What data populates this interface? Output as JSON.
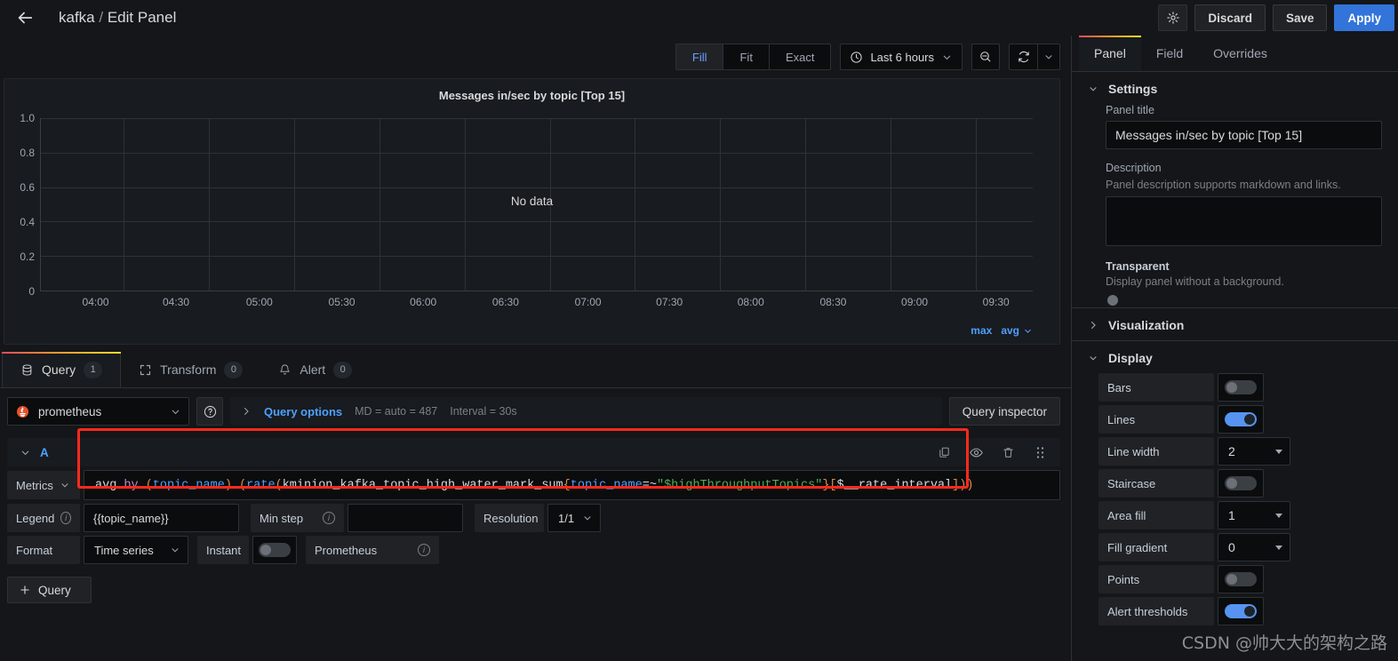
{
  "topbar": {
    "back_icon": "arrow-left-icon",
    "breadcrumb_dashboard": "kafka",
    "breadcrumb_sep": "/",
    "breadcrumb_page": "Edit Panel",
    "settings_icon": "gear-icon",
    "discard_label": "Discard",
    "save_label": "Save",
    "apply_label": "Apply"
  },
  "viz_toolbar": {
    "fit_modes": [
      "Fill",
      "Fit",
      "Exact"
    ],
    "active_fit_mode": "Fill",
    "time_range": "Last 6 hours",
    "clock_icon": "clock-icon",
    "chevron_icon": "chevron-down-icon",
    "zoom_out_icon": "zoom-out-icon",
    "refresh_icon": "refresh-icon",
    "refresh_interval_icon": "chevron-down-icon"
  },
  "chart_data": {
    "type": "line",
    "title": "Messages in/sec by topic [Top 15]",
    "no_data_text": "No data",
    "xlabel": "",
    "ylabel": "",
    "x": [
      "04:00",
      "04:30",
      "05:00",
      "05:30",
      "06:00",
      "06:30",
      "07:00",
      "07:30",
      "08:00",
      "08:30",
      "09:00",
      "09:30"
    ],
    "yticks": [
      "1.0",
      "0.8",
      "0.6",
      "0.4",
      "0.2",
      "0"
    ],
    "ylim": [
      0,
      1.0
    ],
    "series": [],
    "grid": true,
    "legend_position": "bottom-right",
    "legend_calcs": [
      "max",
      "avg"
    ]
  },
  "query_tabs": [
    {
      "label": "Query",
      "count": "1",
      "icon": "database-icon",
      "active": true
    },
    {
      "label": "Transform",
      "count": "0",
      "icon": "transform-icon",
      "active": false
    },
    {
      "label": "Alert",
      "count": "0",
      "icon": "bell-icon",
      "active": false
    }
  ],
  "query_header": {
    "datasource": "prometheus",
    "datasource_icon": "prometheus-logo-icon",
    "datasource_chevron": "chevron-down-icon",
    "help_icon": "question-circle-icon",
    "expand_icon": "chevron-right-icon",
    "query_options_label": "Query options",
    "max_data_points": "MD = auto = 487",
    "interval": "Interval = 30s",
    "query_inspector_label": "Query inspector"
  },
  "query_row": {
    "ref_id": "A",
    "collapse_icon": "chevron-down-icon",
    "actions": [
      "copy-icon",
      "eye-icon",
      "trash-icon",
      "drag-handle-icon"
    ],
    "metrics_label": "Metrics",
    "metrics_chevron": "chevron-down-icon",
    "expression_tokens": [
      {
        "t": "avg ",
        "c": "fn"
      },
      {
        "t": "by",
        "c": "kw"
      },
      {
        "t": " ",
        "c": "fn"
      },
      {
        "t": "(",
        "c": "paren"
      },
      {
        "t": "topic_name",
        "c": "label"
      },
      {
        "t": ")",
        "c": "paren"
      },
      {
        "t": " ",
        "c": "fn"
      },
      {
        "t": "(",
        "c": "paren"
      },
      {
        "t": "rate",
        "c": "label"
      },
      {
        "t": "(",
        "c": "paren"
      },
      {
        "t": "kminion_kafka_topic_high_water_mark_sum",
        "c": "fn"
      },
      {
        "t": "{",
        "c": "br"
      },
      {
        "t": "topic_name",
        "c": "label"
      },
      {
        "t": "=~",
        "c": "fn"
      },
      {
        "t": "\"$highThroughputTopics\"",
        "c": "str"
      },
      {
        "t": "}",
        "c": "br"
      },
      {
        "t": "[",
        "c": "br"
      },
      {
        "t": "$__rate_interval",
        "c": "fn"
      },
      {
        "t": "]",
        "c": "br"
      },
      {
        "t": "))",
        "c": "paren"
      }
    ],
    "expression_plain": "avg by (topic_name) (rate(kminion_kafka_topic_high_water_mark_sum{topic_name=~\"$highThroughputTopics\"}[$__rate_interval]))",
    "legend_label": "Legend",
    "legend_value": "{{topic_name}}",
    "min_step_label": "Min step",
    "min_step_value": "",
    "resolution_label": "Resolution",
    "resolution_value": "1/1",
    "format_label": "Format",
    "format_value": "Time series",
    "instant_label": "Instant",
    "instant_on": false,
    "prometheus_label": "Prometheus"
  },
  "add_query": {
    "label": "Query",
    "icon": "plus-icon"
  },
  "options_tabs": [
    {
      "label": "Panel",
      "active": true
    },
    {
      "label": "Field",
      "active": false
    },
    {
      "label": "Overrides",
      "active": false
    }
  ],
  "settings": {
    "section_label": "Settings",
    "expanded": true,
    "panel_title_label": "Panel title",
    "panel_title_value": "Messages in/sec by topic [Top 15]",
    "description_label": "Description",
    "description_help": "Panel description supports markdown and links.",
    "description_value": "",
    "transparent_label": "Transparent",
    "transparent_help": "Display panel without a background.",
    "transparent_on": false
  },
  "visualization": {
    "section_label": "Visualization",
    "expanded": false
  },
  "display": {
    "section_label": "Display",
    "expanded": true,
    "rows": [
      {
        "label": "Bars",
        "type": "toggle",
        "on": false
      },
      {
        "label": "Lines",
        "type": "toggle",
        "on": true
      },
      {
        "label": "Line width",
        "type": "select",
        "value": "2"
      },
      {
        "label": "Staircase",
        "type": "toggle",
        "on": false
      },
      {
        "label": "Area fill",
        "type": "select",
        "value": "1"
      },
      {
        "label": "Fill gradient",
        "type": "select",
        "value": "0"
      },
      {
        "label": "Points",
        "type": "toggle",
        "on": false
      },
      {
        "label": "Alert thresholds",
        "type": "toggle",
        "on": true
      }
    ]
  },
  "watermark": "CSDN @帅大大的架构之路",
  "colors": {
    "accent_blue": "#3274d9",
    "link_blue": "#4ea0ff",
    "toggle_on": "#5794f2",
    "annotation_red": "#fc2a1c",
    "tab_gradient_start": "#f2495c",
    "tab_gradient_end": "#fade2a"
  }
}
